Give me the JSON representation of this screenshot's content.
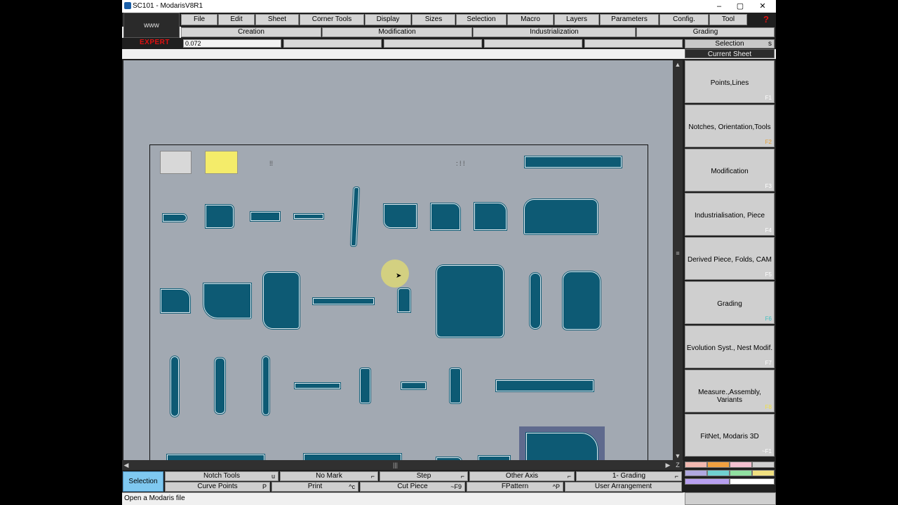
{
  "window": {
    "title": "SC101  - ModarisV8R1",
    "minimize": "–",
    "maximize": "▢",
    "close": "✕"
  },
  "logo": "www",
  "menu": [
    "File",
    "Edit",
    "Sheet",
    "Corner Tools",
    "Display",
    "Sizes",
    "Selection",
    "Macro",
    "Layers",
    "Parameters",
    "Config.",
    "Tool"
  ],
  "help_glyph": "?",
  "submenu": [
    "Creation",
    "Modification",
    "Industrialization",
    "Grading"
  ],
  "mode_label": "EXPERT",
  "value_field": "0.072",
  "selection_tab": {
    "label": "Selection",
    "key": "s"
  },
  "current_sheet": "Current Sheet",
  "side_buttons": [
    {
      "label": "Points,Lines",
      "key": "F1",
      "key_color": "#ffffff"
    },
    {
      "label": "Notches, Orientation,Tools",
      "key": "F2",
      "key_color": "#e8a030"
    },
    {
      "label": "Modification",
      "key": "F3",
      "key_color": "#ffffff"
    },
    {
      "label": "Industrialisation, Piece",
      "key": "F4",
      "key_color": "#ffffff"
    },
    {
      "label": "Derived Piece, Folds, CAM",
      "key": "F5",
      "key_color": "#ffffff"
    },
    {
      "label": "Grading",
      "key": "F6",
      "key_color": "#40c0c0"
    },
    {
      "label": "Evolution Syst., Nest Modif.",
      "key": "F7",
      "key_color": "#ffffff"
    },
    {
      "label": "Measure.,Assembly, Variants",
      "key": "F8",
      "key_color": "#f0e040"
    },
    {
      "label": "FitNet, Modaris 3D",
      "key": "~F1",
      "key_color": "#ffffff"
    }
  ],
  "bottom_selection": "Selection",
  "bottom_row1": [
    {
      "label": "Notch Tools",
      "shortcut": "u"
    },
    {
      "label": "No Mark",
      "shortcut": "⌐"
    },
    {
      "label": "Step",
      "shortcut": "⌐"
    },
    {
      "label": "Other Axis",
      "shortcut": "⌐"
    },
    {
      "label": "1- Grading",
      "shortcut": "⌐"
    }
  ],
  "bottom_row2": [
    {
      "label": "Curve Points",
      "shortcut": "P"
    },
    {
      "label": "Print",
      "shortcut": "^c"
    },
    {
      "label": "Cut Piece",
      "shortcut": "~F9"
    },
    {
      "label": "FPattern",
      "shortcut": "^P"
    },
    {
      "label": "User Arrangement",
      "shortcut": ""
    }
  ],
  "status": "Open a Modaris file",
  "colors": {
    "canvas": "#a2a9b2",
    "piece": "#0d5a74",
    "selection_button": "#7fc8f0",
    "selected_piece_bg": "#5f6a8e",
    "expert_red": "#e01010"
  }
}
